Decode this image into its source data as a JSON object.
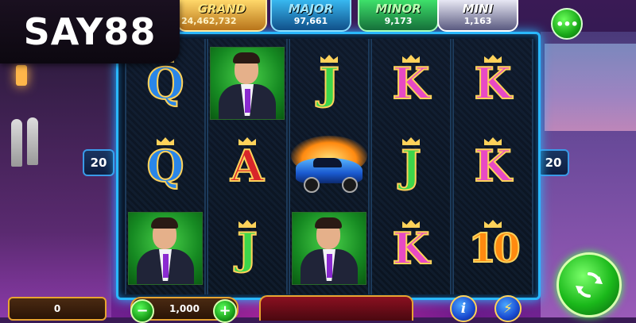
{
  "brand": {
    "logo_text": "SAY88"
  },
  "jackpots": [
    {
      "name": "GRAND",
      "value": "24,462,732"
    },
    {
      "name": "MAJOR",
      "value": "97,661"
    },
    {
      "name": "MINOR",
      "value": "9,173"
    },
    {
      "name": "MINI",
      "value": "1,163"
    }
  ],
  "menu_button": {
    "label": "•••",
    "icon": "menu-icon"
  },
  "paylines": {
    "left": "20",
    "right": "20"
  },
  "reels": [
    [
      "Q",
      "Q",
      "man"
    ],
    [
      "man",
      "A",
      "J"
    ],
    [
      "J",
      "car",
      "man"
    ],
    [
      "K",
      "J",
      "K"
    ],
    [
      "K",
      "K",
      "10"
    ]
  ],
  "symbols": {
    "Q": "Q",
    "J": "J",
    "K": "K",
    "A": "A",
    "10": "10",
    "man": "character-portrait-icon",
    "car": "sports-car-icon"
  },
  "bottom_bar": {
    "win_value": "0",
    "bet_value": "1,000",
    "minus_label": "−",
    "plus_label": "+",
    "info_label": "i",
    "bolt_label": "⚡",
    "spin_icon": "refresh-icon"
  },
  "colors": {
    "reel_border": "#2ab8ff",
    "grand": "#ffd86a",
    "major": "#38b8f0",
    "minor": "#3ee06a",
    "mini": "#e8e8f4",
    "spin_button": "#1ab81a"
  }
}
